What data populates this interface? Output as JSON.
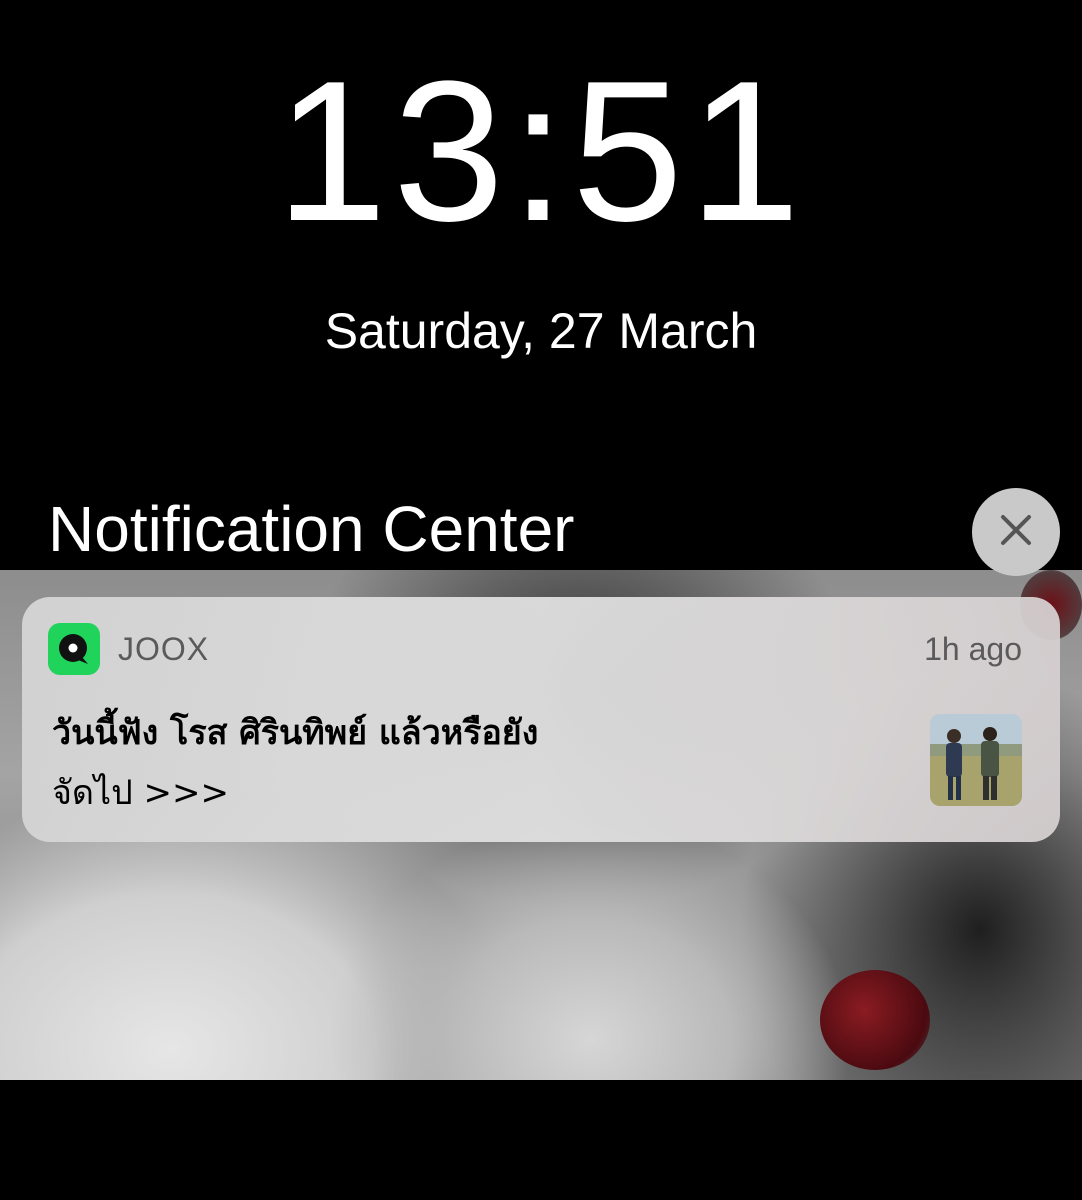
{
  "lock_screen": {
    "time": "13:51",
    "date": "Saturday, 27 March"
  },
  "notification_center": {
    "title": "Notification Center",
    "clear_icon": "close-icon"
  },
  "notification": {
    "app_name": "JOOX",
    "app_icon": "joox-icon",
    "timestamp": "1h ago",
    "title": "วันนี้ฟัง โรส ศิรินทิพย์ แล้วหรือยัง",
    "body": "จัดไป >>>",
    "thumbnail": "album-thumbnail"
  },
  "colors": {
    "background": "#000000",
    "joox_green": "#1fd35b",
    "clear_button": "#c9c9c9",
    "notification_bg": "#d9d9d9"
  }
}
